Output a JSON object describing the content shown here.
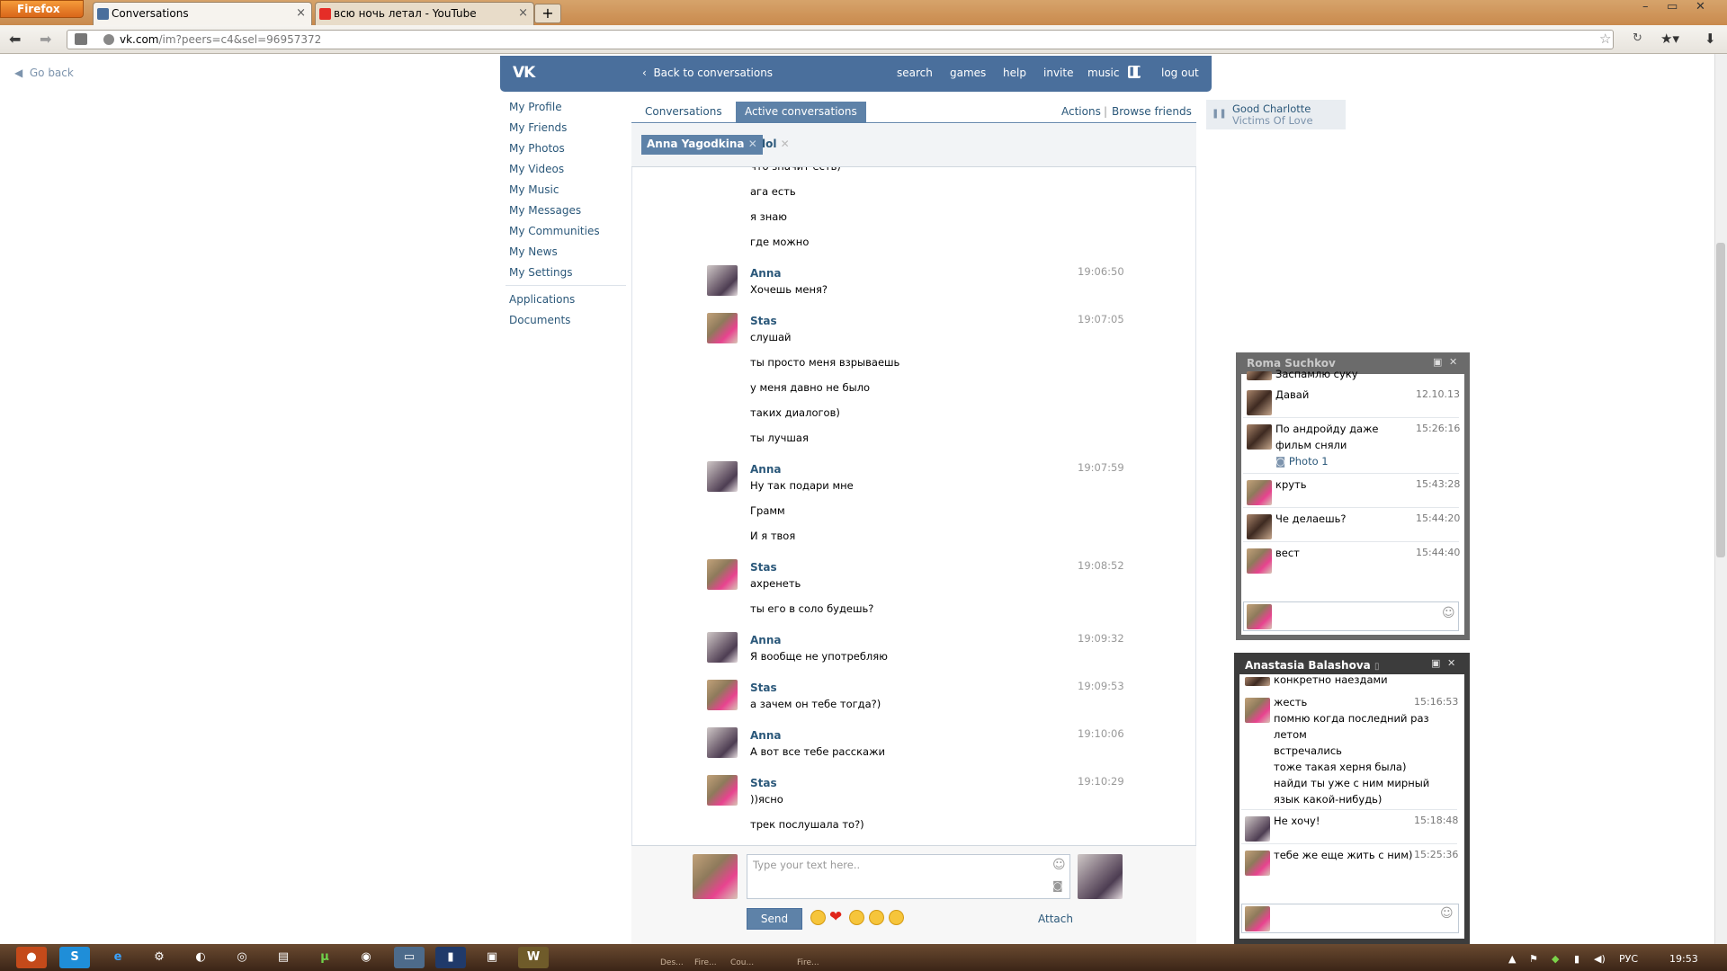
{
  "browser": {
    "menu_label": "Firefox",
    "tabs": [
      {
        "title": "Conversations",
        "active": true
      },
      {
        "title": "всю ночь летал - YouTube",
        "active": false
      }
    ],
    "new_tab": "+",
    "url_host": "vk.com",
    "url_path": "/im?peers=c4&sel=96957372"
  },
  "page": {
    "go_back": "Go back",
    "header": {
      "back": "Back to conversations",
      "nav": [
        "search",
        "games",
        "help",
        "invite",
        "music",
        "log out"
      ]
    },
    "left_menu": [
      "My Profile",
      "My Friends",
      "My Photos",
      "My Videos",
      "My Music",
      "My Messages",
      "My Communities",
      "My News",
      "My Settings"
    ],
    "left_menu_extra": [
      "Applications",
      "Documents"
    ],
    "tabs": [
      "Conversations",
      "Active conversations"
    ],
    "actions": "Actions",
    "actions_sep": "|",
    "browse_friends": "Browse friends",
    "peers": [
      "Anna Yagodkina",
      "lol"
    ],
    "now_playing": {
      "artist": "Good Charlotte",
      "track": "Victims Of Love"
    },
    "messages": [
      {
        "author": "",
        "time": "",
        "lines": [
          "что значит есть)",
          "ага есть",
          "я знаю",
          "где можно"
        ],
        "avatar": "anna"
      },
      {
        "author": "Anna",
        "time": "19:06:50",
        "lines": [
          "Хочешь меня?"
        ],
        "avatar": "anna"
      },
      {
        "author": "Stas",
        "time": "19:07:05",
        "lines": [
          "слушай",
          "ты просто меня взрываешь",
          "у меня давно не было",
          "таких диалогов)",
          "ты лучшая"
        ],
        "avatar": "stas"
      },
      {
        "author": "Anna",
        "time": "19:07:59",
        "lines": [
          "Ну так подари мне",
          "Грамм",
          "И я твоя"
        ],
        "avatar": "anna"
      },
      {
        "author": "Stas",
        "time": "19:08:52",
        "lines": [
          "ахренеть",
          "ты его в соло будешь?"
        ],
        "avatar": "stas"
      },
      {
        "author": "Anna",
        "time": "19:09:32",
        "lines": [
          "Я вообще не употребляю"
        ],
        "avatar": "anna"
      },
      {
        "author": "Stas",
        "time": "19:09:53",
        "lines": [
          "а зачем он тебе тогда?)"
        ],
        "avatar": "stas"
      },
      {
        "author": "Anna",
        "time": "19:10:06",
        "lines": [
          "А вот все тебе расскажи"
        ],
        "avatar": "anna"
      },
      {
        "author": "Stas",
        "time": "19:10:29",
        "lines": [
          "))ясно",
          "трек послушала то?)"
        ],
        "avatar": "stas"
      }
    ],
    "composer": {
      "placeholder": "Type your text here..",
      "send": "Send",
      "attach": "Attach"
    }
  },
  "chat_windows": [
    {
      "title": "Roma Suchkov",
      "clipped_line": "Заспамлю суку",
      "rows": [
        {
          "text": [
            "Давай"
          ],
          "time": "12.10.13",
          "avatar": "roma"
        },
        {
          "text": [
            "По андройду даже",
            "фильм сняли"
          ],
          "time": "15:26:16",
          "avatar": "roma",
          "attachment": "Photo 1"
        },
        {
          "text": [
            "круть"
          ],
          "time": "15:43:28",
          "avatar": "stas"
        },
        {
          "text": [
            "Че делаешь?"
          ],
          "time": "15:44:20",
          "avatar": "roma"
        },
        {
          "text": [
            "вест"
          ],
          "time": "15:44:40",
          "avatar": "stas"
        }
      ]
    },
    {
      "title": "Anastasia Balashova",
      "clipped_line": "конкретно наездами",
      "rows": [
        {
          "text": [
            "жесть",
            "помню когда последний раз",
            "летом",
            "встречались",
            "тоже такая херня была)",
            "найди ты уже с ним мирный",
            "язык какой-нибудь)"
          ],
          "time": "15:16:53",
          "avatar": "stas"
        },
        {
          "text": [
            "Не хочу!"
          ],
          "time": "15:18:48",
          "avatar": "anna"
        },
        {
          "text": [
            "тебе же еще жить с ним)"
          ],
          "time": "15:25:36",
          "avatar": "stas"
        }
      ]
    }
  ],
  "taskbar": {
    "lang": "РУС",
    "clock": "19:53",
    "labels": [
      "Des...",
      "Fire...",
      "Cou...",
      "Fire..."
    ]
  },
  "colors": {
    "vk_header": "#4a6f9c",
    "link": "#2b587a",
    "tab_selected": "#5e82a8"
  }
}
